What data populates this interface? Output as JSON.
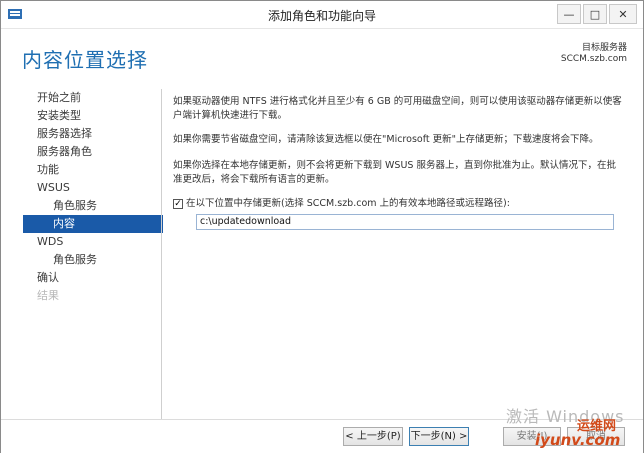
{
  "window": {
    "title": "添加角色和功能向导",
    "buttons": {
      "minimize": "—",
      "maximize": "□",
      "close": "✕"
    }
  },
  "header": {
    "page_title": "内容位置选择",
    "server_label": "目标服务器",
    "server_name": "SCCM.szb.com"
  },
  "sidebar": {
    "items": [
      {
        "label": "开始之前",
        "level": 0,
        "state": "normal"
      },
      {
        "label": "安装类型",
        "level": 0,
        "state": "normal"
      },
      {
        "label": "服务器选择",
        "level": 0,
        "state": "normal"
      },
      {
        "label": "服务器角色",
        "level": 0,
        "state": "normal"
      },
      {
        "label": "功能",
        "level": 0,
        "state": "normal"
      },
      {
        "label": "WSUS",
        "level": 0,
        "state": "normal"
      },
      {
        "label": "角色服务",
        "level": 1,
        "state": "normal"
      },
      {
        "label": "内容",
        "level": 1,
        "state": "active"
      },
      {
        "label": "WDS",
        "level": 0,
        "state": "normal"
      },
      {
        "label": "角色服务",
        "level": 1,
        "state": "normal"
      },
      {
        "label": "确认",
        "level": 0,
        "state": "normal"
      },
      {
        "label": "结果",
        "level": 0,
        "state": "disabled"
      }
    ]
  },
  "content": {
    "para1": "如果驱动器使用 NTFS 进行格式化并且至少有 6 GB 的可用磁盘空间，则可以使用该驱动器存储更新以使客户端计算机快速进行下载。",
    "para2": "如果你需要节省磁盘空间，请清除该复选框以便在\"Microsoft 更新\"上存储更新；下载速度将会下降。",
    "para3": "如果你选择在本地存储更新，则不会将更新下载到 WSUS 服务器上，直到你批准为止。默认情况下，在批准更改后，将会下载所有语言的更新。",
    "checkbox_label": "在以下位置中存储更新(选择 SCCM.szb.com 上的有效本地路径或远程路径):",
    "checkbox_checked": "✓",
    "path_value": "c:\\updatedownload"
  },
  "footer": {
    "prev_label": "< 上一步(P)",
    "next_label": "下一步(N) >",
    "install_label": "安装(I)",
    "cancel_label": "取消"
  },
  "overlay": {
    "watermark_text": "激活 Windows",
    "logo_top": "运维网",
    "logo_bottom": "iyunv.com"
  },
  "colors": {
    "accent": "#1a5aa8",
    "title_blue": "#1f6fb2"
  }
}
